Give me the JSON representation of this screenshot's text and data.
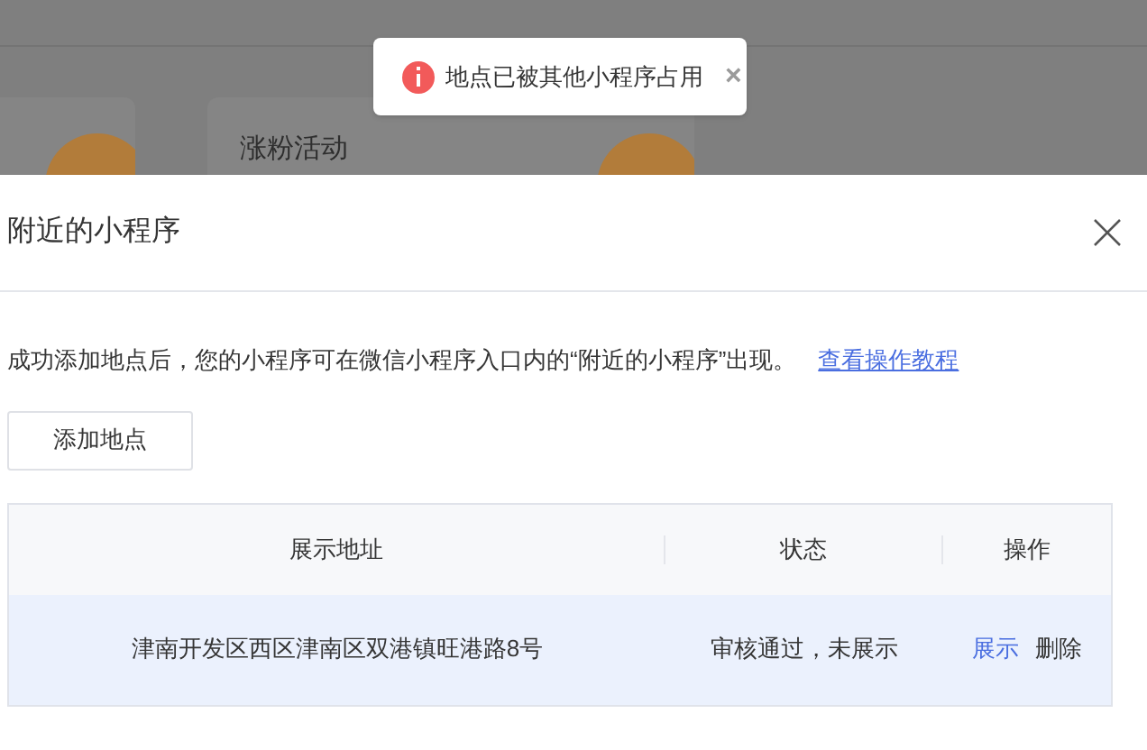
{
  "background": {
    "card_title": "涨粉活动"
  },
  "toast": {
    "message": "地点已被其他小程序占用",
    "close": "×"
  },
  "dialog": {
    "title": "附近的小程序",
    "description": "成功添加地点后，您的小程序可在微信小程序入口内的“附近的小程序”出现。",
    "link": "查看操作教程",
    "add_button": "添加地点",
    "table": {
      "columns": [
        "展示地址",
        "状态",
        "操作"
      ],
      "rows": [
        {
          "address": "津南开发区西区津南区双港镇旺港路8号",
          "status": "审核通过，未展示",
          "selected": true,
          "actions": [
            {
              "label": "展示",
              "kind": "primary"
            },
            {
              "label": "删除",
              "kind": "default"
            }
          ]
        }
      ]
    }
  }
}
